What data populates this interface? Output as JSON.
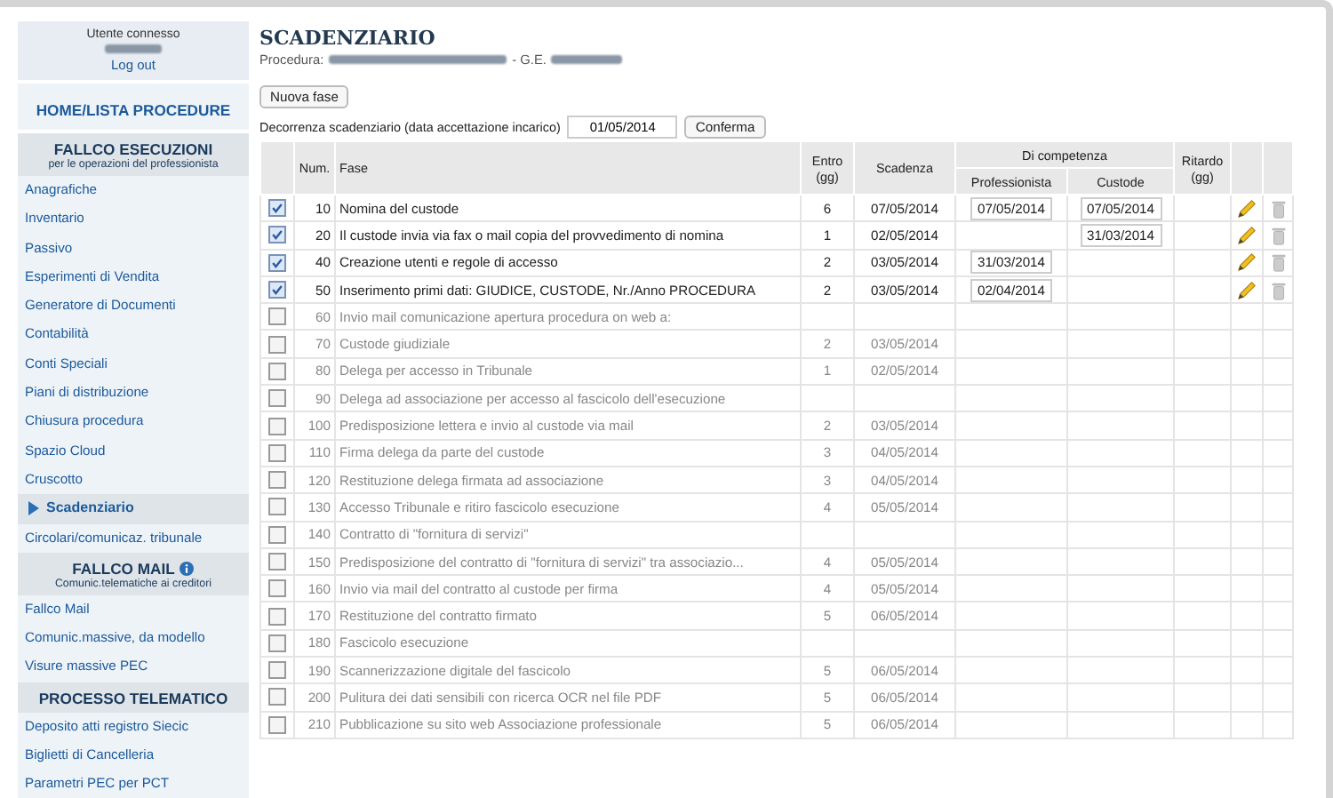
{
  "sidebar": {
    "user_label": "Utente connesso",
    "logout": "Log out",
    "home": "HOME/LISTA PROCEDURE",
    "sections": [
      {
        "title": "FALLCO ESECUZIONI",
        "subtitle": "per le operazioni del professionista",
        "info": false,
        "items": [
          {
            "label": "Anagrafiche",
            "selected": false
          },
          {
            "label": "Inventario",
            "selected": false
          },
          {
            "label": "Passivo",
            "selected": false
          },
          {
            "label": "Esperimenti di Vendita",
            "selected": false
          },
          {
            "label": "Generatore di Documenti",
            "selected": false
          },
          {
            "label": "Contabilità",
            "selected": false
          },
          {
            "label": "Conti Speciali",
            "selected": false
          },
          {
            "label": "Piani di distribuzione",
            "selected": false
          },
          {
            "label": "Chiusura procedura",
            "selected": false
          },
          {
            "label": "Spazio Cloud",
            "selected": false
          },
          {
            "label": "Cruscotto",
            "selected": false
          },
          {
            "label": "Scadenziario",
            "selected": true
          },
          {
            "label": "Circolari/comunicaz. tribunale",
            "selected": false
          }
        ]
      },
      {
        "title": "FALLCO MAIL",
        "subtitle": "Comunic.telematiche ai creditori",
        "info": true,
        "items": [
          {
            "label": "Fallco Mail",
            "selected": false
          },
          {
            "label": "Comunic.massive, da modello",
            "selected": false
          },
          {
            "label": "Visure massive PEC",
            "selected": false
          }
        ]
      },
      {
        "title": "PROCESSO TELEMATICO",
        "info": false,
        "items": [
          {
            "label": "Deposito atti registro Siecic",
            "selected": false
          },
          {
            "label": "Biglietti di Cancelleria",
            "selected": false
          },
          {
            "label": "Parametri PEC per PCT",
            "selected": false
          }
        ]
      }
    ]
  },
  "main": {
    "title": "SCADENZIARIO",
    "procedura_label": "Procedura:",
    "ge_label": "- G.E.",
    "new_button": "Nuova fase",
    "start_label": "Decorrenza scadenziario (data accettazione incarico)",
    "start_date": "01/05/2014",
    "confirm_button": "Conferma"
  },
  "table": {
    "columns": {
      "num": "Num.",
      "fase": "Fase",
      "entro": "Entro (gg)",
      "scadenza": "Scadenza",
      "group": "Di competenza",
      "professionista": "Professionista",
      "custode": "Custode",
      "ritardo": "Ritardo (gg)"
    },
    "rows": [
      {
        "checked": true,
        "num": "10",
        "fase": "Nomina del custode",
        "entro": "6",
        "scadenza": "07/05/2014",
        "professionista": "07/05/2014",
        "custode": "07/05/2014"
      },
      {
        "checked": true,
        "num": "20",
        "fase": "Il custode invia via fax o mail copia del provvedimento di nomina",
        "entro": "1",
        "scadenza": "02/05/2014",
        "custode": "31/03/2014"
      },
      {
        "checked": true,
        "num": "40",
        "fase": "Creazione utenti e regole di accesso",
        "entro": "2",
        "scadenza": "03/05/2014",
        "professionista": "31/03/2014"
      },
      {
        "checked": true,
        "num": "50",
        "fase": "Inserimento primi dati: GIUDICE, CUSTODE, Nr./Anno PROCEDURA",
        "entro": "2",
        "scadenza": "03/05/2014",
        "professionista": "02/04/2014"
      },
      {
        "checked": false,
        "num": "60",
        "fase": "Invio mail comunicazione apertura procedura on web a:"
      },
      {
        "checked": false,
        "num": "70",
        "fase": "Custode giudiziale",
        "entro": "2",
        "scadenza": "03/05/2014"
      },
      {
        "checked": false,
        "num": "80",
        "fase": "Delega per accesso in Tribunale",
        "entro": "1",
        "scadenza": "02/05/2014"
      },
      {
        "checked": false,
        "num": "90",
        "fase": "Delega ad associazione per accesso al fascicolo dell'esecuzione"
      },
      {
        "checked": false,
        "num": "100",
        "fase": "Predisposizione lettera e invio al custode via mail",
        "entro": "2",
        "scadenza": "03/05/2014"
      },
      {
        "checked": false,
        "num": "110",
        "fase": "Firma delega da parte del custode",
        "entro": "3",
        "scadenza": "04/05/2014"
      },
      {
        "checked": false,
        "num": "120",
        "fase": "Restituzione delega firmata ad associazione",
        "entro": "3",
        "scadenza": "04/05/2014"
      },
      {
        "checked": false,
        "num": "130",
        "fase": "Accesso Tribunale e ritiro fascicolo esecuzione",
        "entro": "4",
        "scadenza": "05/05/2014"
      },
      {
        "checked": false,
        "num": "140",
        "fase": "Contratto di \"fornitura di servizi\""
      },
      {
        "checked": false,
        "num": "150",
        "fase": "Predisposizione del contratto di \"fornitura di servizi\" tra associazio...",
        "entro": "4",
        "scadenza": "05/05/2014"
      },
      {
        "checked": false,
        "num": "160",
        "fase": "Invio via mail del contratto al custode per firma",
        "entro": "4",
        "scadenza": "05/05/2014"
      },
      {
        "checked": false,
        "num": "170",
        "fase": "Restituzione del contratto firmato",
        "entro": "5",
        "scadenza": "06/05/2014"
      },
      {
        "checked": false,
        "num": "180",
        "fase": "Fascicolo esecuzione"
      },
      {
        "checked": false,
        "num": "190",
        "fase": "Scannerizzazione digitale del fascicolo",
        "entro": "5",
        "scadenza": "06/05/2014"
      },
      {
        "checked": false,
        "num": "200",
        "fase": "Pulitura dei dati sensibili con ricerca OCR nel file PDF",
        "entro": "5",
        "scadenza": "06/05/2014"
      },
      {
        "checked": false,
        "num": "210",
        "fase": "Pubblicazione su sito web Associazione professionale",
        "entro": "5",
        "scadenza": "06/05/2014"
      }
    ]
  }
}
